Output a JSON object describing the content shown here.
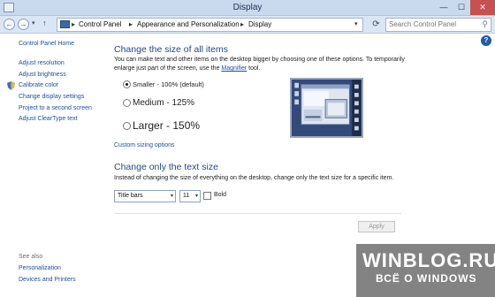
{
  "window": {
    "title": "Display",
    "minimize_glyph": "—",
    "maximize_glyph": "☐",
    "close_glyph": "✕"
  },
  "nav": {
    "back_glyph": "←",
    "forward_glyph": "→",
    "recent_glyph": "▾",
    "up_glyph": "↑",
    "refresh_glyph": "⟳"
  },
  "address": {
    "breadcrumbs": [
      "Control Panel",
      "Appearance and Personalization",
      "Display"
    ],
    "separator": "▸",
    "dropdown_glyph": "▾"
  },
  "search": {
    "placeholder": "Search Control Panel",
    "icon": "search-icon",
    "icon_glyph": "⚲"
  },
  "help": {
    "glyph": "?"
  },
  "sidebar": {
    "home": "Control Panel Home",
    "items": [
      "Adjust resolution",
      "Adjust brightness",
      "Calibrate color",
      "Change display settings",
      "Project to a second screen",
      "Adjust ClearType text"
    ],
    "see_also_heading": "See also",
    "see_also": [
      "Personalization",
      "Devices and Printers"
    ]
  },
  "main": {
    "size_heading": "Change the size of all items",
    "size_desc_prefix": "You can make text and other items on the desktop bigger by choosing one of these options. To temporarily enlarge just part of the screen, use the ",
    "magnifier_link": "Magnifier",
    "size_desc_suffix": " tool.",
    "options": [
      {
        "label": "Smaller - 100% (default)",
        "selected": true
      },
      {
        "label": "Medium - 125%",
        "selected": false
      },
      {
        "label": "Larger - 150%",
        "selected": false
      }
    ],
    "custom_link": "Custom sizing options",
    "text_heading": "Change only the text size",
    "text_desc": "Instead of changing the size of everything on the desktop, change only the text size for a specific item.",
    "item_select": "Title bars",
    "size_select": "11",
    "select_arrow": "▾",
    "bold_label": "Bold",
    "bold_checked": false,
    "apply_label": "Apply"
  },
  "watermark": {
    "line1": "WINBLOG.RU",
    "line2": "ВСЁ О WINDOWS"
  },
  "colors": {
    "link": "#1a4f9c",
    "heading": "#1e4a8c",
    "close_button": "#c75050",
    "preview_bg": "#334a78"
  }
}
